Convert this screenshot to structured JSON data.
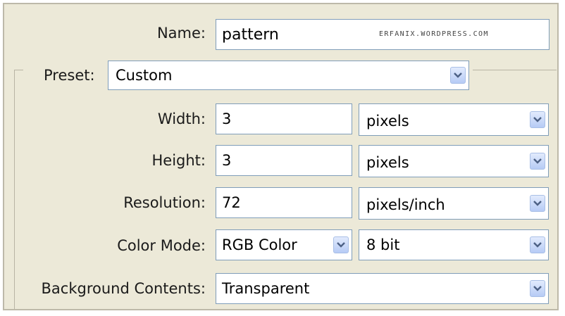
{
  "dialog": {
    "name": {
      "label": "Name:",
      "value": "pattern",
      "watermark": "ERFANIX.WORDPRESS.COM"
    },
    "preset": {
      "label": "Preset:",
      "value": "Custom"
    },
    "width": {
      "label": "Width:",
      "value": "3",
      "unit": "pixels"
    },
    "height": {
      "label": "Height:",
      "value": "3",
      "unit": "pixels"
    },
    "resolution": {
      "label": "Resolution:",
      "value": "72",
      "unit": "pixels/inch"
    },
    "color_mode": {
      "label": "Color Mode:",
      "value": "RGB Color",
      "depth": "8 bit"
    },
    "background_contents": {
      "label": "Background Contents:",
      "value": "Transparent"
    }
  },
  "icons": {
    "dropdown": "chevron-down-icon"
  },
  "colors": {
    "dialog_bg": "#ece9d8",
    "field_border": "#7f9db9",
    "dropdown_button": "#b6cbf5",
    "chevron": "#4d6185"
  }
}
